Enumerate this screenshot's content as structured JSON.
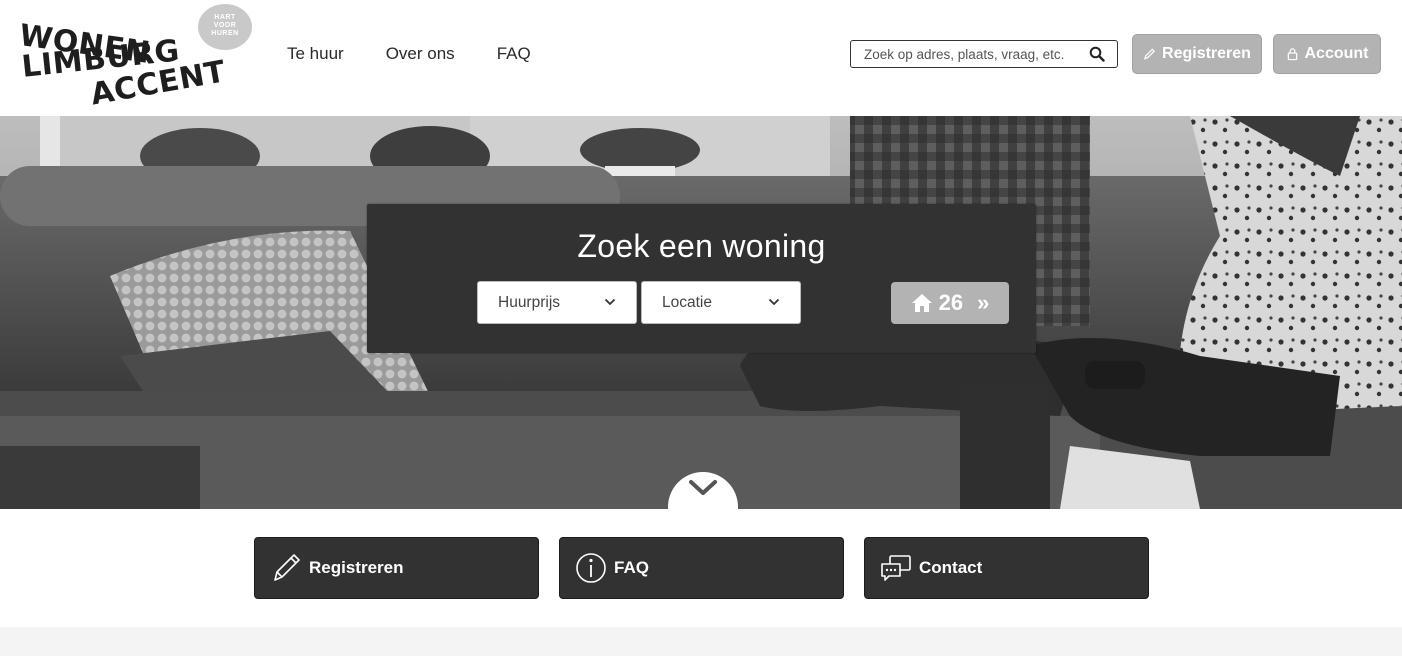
{
  "logo": {
    "line1": "WONEN",
    "line2": "LIMBURG",
    "line3": "ACCENT",
    "badge_line1": "HART",
    "badge_line2": "VOOR",
    "badge_line3": "HUREN"
  },
  "nav": {
    "items": [
      {
        "label": "Te huur"
      },
      {
        "label": "Over ons"
      },
      {
        "label": "FAQ"
      }
    ]
  },
  "search": {
    "placeholder": "Zoek op adres, plaats, vraag, etc.",
    "icon": "search-icon"
  },
  "header_buttons": {
    "register_label": "Registreren",
    "account_label": "Account"
  },
  "hero": {
    "title": "Zoek een woning",
    "filters": [
      {
        "label": "Huurprijs"
      },
      {
        "label": "Locatie"
      }
    ],
    "result_count": "26",
    "result_arrow": "»"
  },
  "quick_links": [
    {
      "label": "Registreren",
      "icon": "pencil-icon"
    },
    {
      "label": "FAQ",
      "icon": "info-icon"
    },
    {
      "label": "Contact",
      "icon": "chat-icon"
    }
  ],
  "colors": {
    "panel": "#323232",
    "button_grey": "#b3b3b3",
    "text": "#2a2a2a"
  }
}
